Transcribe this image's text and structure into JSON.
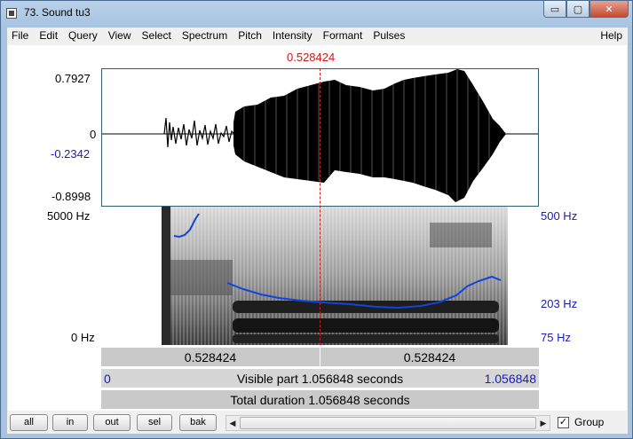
{
  "window": {
    "title": "73. Sound tu3",
    "buttons": {
      "minimize": "▭",
      "maximize": "▢",
      "close": "✕"
    }
  },
  "menu": {
    "items": [
      "File",
      "Edit",
      "Query",
      "View",
      "Select",
      "Spectrum",
      "Pitch",
      "Intensity",
      "Formant",
      "Pulses"
    ],
    "help": "Help"
  },
  "cursor": {
    "time": "0.528424"
  },
  "waveform": {
    "max": "0.7927",
    "zero": "0",
    "cursor_value": "-0.2342",
    "min": "-0.8998"
  },
  "spectrogram": {
    "freq_top": "5000 Hz",
    "freq_bottom": "0 Hz",
    "pitch_top": "500 Hz",
    "pitch_value": "203 Hz",
    "pitch_bottom": "75 Hz"
  },
  "bars": {
    "left_part": "0.528424",
    "right_part": "0.528424",
    "visible_text": "Visible part 1.056848 seconds",
    "visible_start": "0",
    "visible_end": "1.056848",
    "total_text": "Total duration 1.056848 seconds"
  },
  "bottom": {
    "zoom_buttons": [
      "all",
      "in",
      "out",
      "sel",
      "bak"
    ],
    "group_label": "Group",
    "group_checked": "✓"
  },
  "colors": {
    "cursor": "#d01818",
    "pitch": "#1144dd",
    "label_blue": "#1c1cb4"
  }
}
